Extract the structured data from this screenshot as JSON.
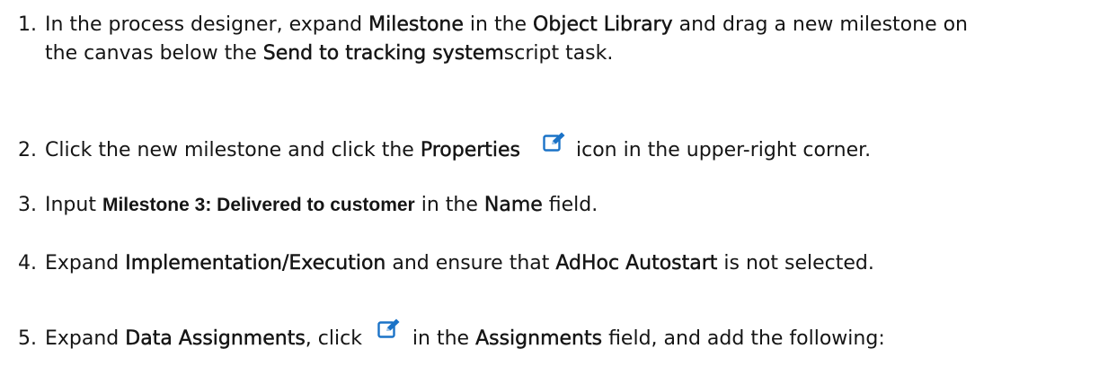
{
  "steps": [
    {
      "num": "1.",
      "t1": "In the process designer, expand ",
      "b1": "Milestone",
      "t2": " in the ",
      "b2": "Object Library",
      "t3": " and drag a new milestone on",
      "t4": "the canvas below the ",
      "b3": "Send to tracking system",
      "t5": "script task."
    },
    {
      "num": "2.",
      "t1": "Click the new milestone and click the ",
      "b1": "Properties",
      "icon": "edit-pencil-icon",
      "t2": " icon in the upper-right corner."
    },
    {
      "num": "3.",
      "t1": "Input ",
      "b1": "Milestone 3: Delivered to customer",
      "t2": " in the ",
      "b2": "Name",
      "t3": " field."
    },
    {
      "num": "4.",
      "t1": "Expand ",
      "b1": "Implementation/Execution",
      "t2": " and ensure that ",
      "b2": "AdHoc Autostart",
      "t3": " is not selected."
    },
    {
      "num": "5.",
      "t1": "Expand ",
      "b1": "Data Assignments",
      "t2": ", click ",
      "icon": "edit-pencil-icon",
      "t3": " in the ",
      "b2": "Assignments",
      "t4": " field, and add the following:"
    }
  ],
  "colors": {
    "text": "#151515",
    "icon_blue": "#1b73c7"
  }
}
